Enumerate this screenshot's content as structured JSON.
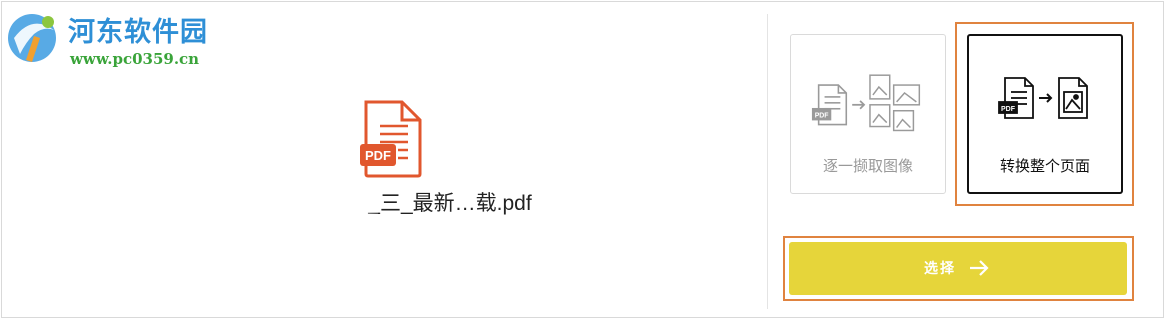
{
  "watermark": {
    "title": "河东软件园",
    "url": "www.pc0359.cn"
  },
  "file": {
    "icon_text": "PDF",
    "name": "_三_最新…载.pdf"
  },
  "options": [
    {
      "label": "逐一撷取图像",
      "selected": false
    },
    {
      "label": "转换整个页面",
      "selected": true
    }
  ],
  "select_button": {
    "label": "选择"
  },
  "colors": {
    "pdf_red": "#e1572e",
    "select_yellow": "#e6d53a",
    "highlight_orange": "#e0833f",
    "watermark_blue": "#2e8fd6",
    "watermark_green": "#3aa43a"
  }
}
